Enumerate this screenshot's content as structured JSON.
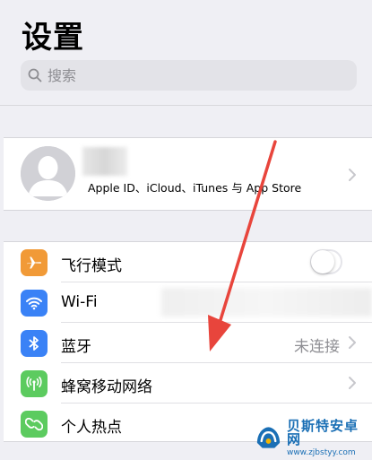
{
  "header": {
    "title": "设置"
  },
  "search": {
    "placeholder": "搜索",
    "icon": "search-icon"
  },
  "profile": {
    "subtitle": "Apple ID、iCloud、iTunes 与 App Store",
    "avatar_icon": "person-silhouette-icon"
  },
  "settings": {
    "items": [
      {
        "label": "飞行模式",
        "icon": "airplane-icon",
        "icon_color": "#f19a37",
        "control": "toggle",
        "toggle_on": false
      },
      {
        "label": "Wi-Fi",
        "icon": "wifi-icon",
        "icon_color": "#3a82f6",
        "control": "none"
      },
      {
        "label": "蓝牙",
        "icon": "bluetooth-icon",
        "icon_color": "#3a82f6",
        "value": "未连接",
        "control": "chevron"
      },
      {
        "label": "蜂窝移动网络",
        "icon": "cellular-icon",
        "icon_color": "#5ccb5f",
        "control": "chevron"
      },
      {
        "label": "个人热点",
        "icon": "hotspot-icon",
        "icon_color": "#5ccb5f",
        "control": "none"
      }
    ]
  },
  "colors": {
    "background": "#efeff4",
    "annotation_arrow": "#e8453c"
  },
  "watermark": {
    "name": "贝斯特安卓网",
    "url": "www.zjbstyy.com"
  }
}
